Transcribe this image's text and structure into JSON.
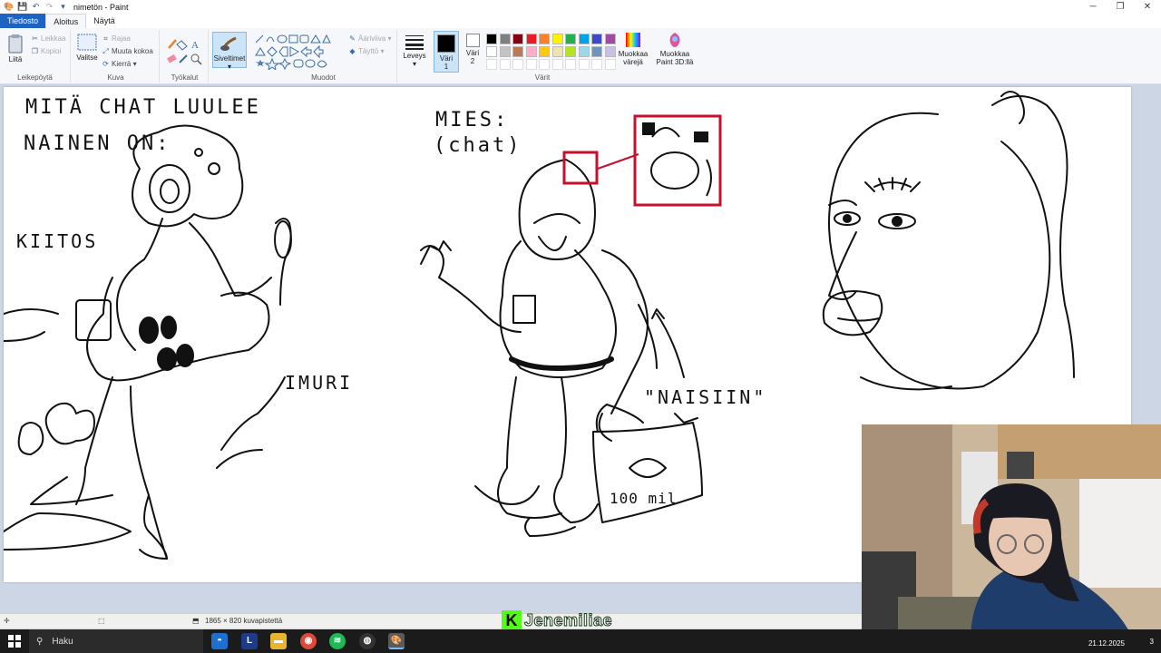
{
  "window": {
    "title": "nimetön - Paint",
    "controls": [
      "─",
      "❐",
      "✕"
    ]
  },
  "tabs": [
    {
      "label": "Tiedosto"
    },
    {
      "label": "Aloitus"
    },
    {
      "label": "Näytä"
    }
  ],
  "ribbon": {
    "clipboard": {
      "group_label": "Leikepöytä",
      "paste": "Liitä",
      "cut": "Leikkaa",
      "copy": "Kopioi"
    },
    "image": {
      "group_label": "Kuva",
      "select": "Valitse",
      "crop": "Rajaa",
      "resize": "Muuta kokoa",
      "rotate": "Kierrä"
    },
    "tools": {
      "group_label": "Työkalut"
    },
    "brushes": {
      "label": "Siveltimet"
    },
    "shapes": {
      "group_label": "Muodot",
      "outline": "Ääriviiva",
      "fill": "Täyttö"
    },
    "size": {
      "label": "Leveys"
    },
    "color1": {
      "label_line1": "Väri",
      "label_line2": "1"
    },
    "color2": {
      "label_line1": "Väri",
      "label_line2": "2"
    },
    "colors": {
      "group_label": "Värit"
    },
    "edit_colors": {
      "line1": "Muokkaa",
      "line2": "värejä"
    },
    "paint3d": {
      "line1": "Muokkaa",
      "line2": "Paint 3D:llä"
    }
  },
  "palette": {
    "row1": [
      "#000000",
      "#7f7f7f",
      "#880015",
      "#ed1c24",
      "#ff7f27",
      "#fff200",
      "#22b14c",
      "#00a2e8",
      "#3f48cc",
      "#a349a4"
    ],
    "row2": [
      "#ffffff",
      "#c3c3c3",
      "#b97a57",
      "#ffaec9",
      "#ffc90e",
      "#efe4b0",
      "#b5e61d",
      "#99d9ea",
      "#7092be",
      "#c8bfe7"
    ],
    "active_color1": "#000000",
    "active_color2": "#ffffff",
    "accent": "#1d63c1"
  },
  "drawing": {
    "left_title_line1": "MITÄ CHAT LUULEE",
    "left_title_line2": "NAINEN ON:",
    "kiitos": "KIITOS",
    "imuri": "IMURI",
    "mid_title_line1": "MIES:",
    "mid_title_line2": "(chat)",
    "naisiin": "\"NAISIIN\"",
    "money": "100 mil",
    "highlight_color": "#c8102e"
  },
  "statusbar": {
    "dimensions": "1865 × 820 kuvapistettä"
  },
  "streamer": {
    "logo": "K",
    "name": "Jenemiliae"
  },
  "taskbar": {
    "search_label": "Haku",
    "date": "21.12.2025",
    "notification_count": "3"
  }
}
